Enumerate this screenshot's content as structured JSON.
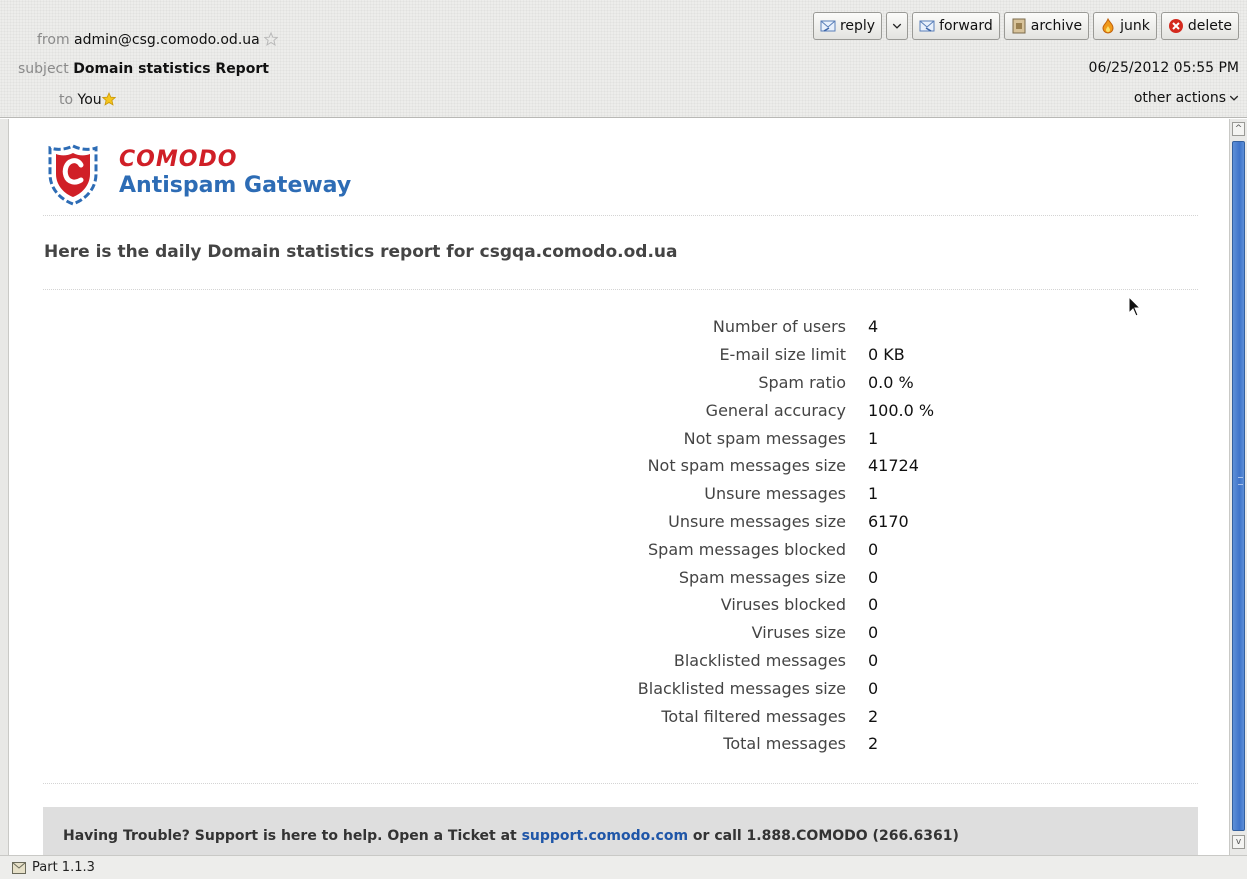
{
  "header": {
    "from_label": "from",
    "from_value": "admin@csg.comodo.od.ua",
    "subject_label": "subject",
    "subject_value": "Domain statistics Report",
    "to_label": "to",
    "to_value": "You",
    "date": "06/25/2012 05:55 PM",
    "other_actions": "other actions"
  },
  "toolbar": {
    "reply": "reply",
    "forward": "forward",
    "archive": "archive",
    "junk": "junk",
    "delete": "delete"
  },
  "message": {
    "brand_top": "COMODO",
    "brand_bottom": "Antispam Gateway",
    "intro": "Here is the daily Domain statistics report for csgqa.comodo.od.ua",
    "stats": [
      {
        "label": "Number of users",
        "value": "4"
      },
      {
        "label": "E-mail size limit",
        "value": "0 KB"
      },
      {
        "label": "Spam ratio",
        "value": "0.0 %"
      },
      {
        "label": "General accuracy",
        "value": "100.0 %"
      },
      {
        "label": "Not spam messages",
        "value": "1"
      },
      {
        "label": "Not spam messages size",
        "value": "41724"
      },
      {
        "label": "Unsure messages",
        "value": "1"
      },
      {
        "label": "Unsure messages size",
        "value": "6170"
      },
      {
        "label": "Spam messages blocked",
        "value": "0"
      },
      {
        "label": "Spam messages size",
        "value": "0"
      },
      {
        "label": "Viruses blocked",
        "value": "0"
      },
      {
        "label": "Viruses size",
        "value": "0"
      },
      {
        "label": "Blacklisted messages",
        "value": "0"
      },
      {
        "label": "Blacklisted messages size",
        "value": "0"
      },
      {
        "label": "Total filtered messages",
        "value": "2"
      },
      {
        "label": "Total messages",
        "value": "2"
      }
    ],
    "footer_prefix": "Having Trouble? Support is here to help. Open a Ticket at ",
    "footer_link": "support.comodo.com",
    "footer_suffix": " or call 1.888.COMODO (266.6361)"
  },
  "partbar": {
    "label": "Part 1.1.3"
  },
  "colors": {
    "brand_red": "#d01f27",
    "brand_blue": "#2d6cb5",
    "link": "#1f56a8",
    "scroll_thumb": "#3f74c9"
  }
}
